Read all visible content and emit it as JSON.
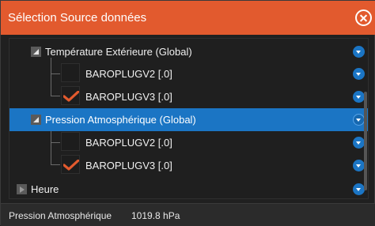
{
  "dialog": {
    "title": "Sélection Source données",
    "close_icon": "close-circle-icon"
  },
  "tree": [
    {
      "type": "group",
      "label": "Température Extérieure (Global)",
      "expanded": true,
      "selected": false
    },
    {
      "type": "source",
      "label": "BAROPLUGV2 [.0]",
      "checked": false
    },
    {
      "type": "source",
      "label": "BAROPLUGV3 [.0]",
      "checked": true
    },
    {
      "type": "group",
      "label": "Pression Atmosphérique (Global)",
      "expanded": true,
      "selected": true
    },
    {
      "type": "source",
      "label": "BAROPLUGV2 [.0]",
      "checked": false
    },
    {
      "type": "source",
      "label": "BAROPLUGV3 [.0]",
      "checked": true
    },
    {
      "type": "group",
      "label": "Heure",
      "expanded": false,
      "selected": false
    }
  ],
  "status": {
    "label": "Pression Atmosphérique",
    "value": "1019.8 hPa"
  },
  "colors": {
    "title_bar": "#e25a2e",
    "selection": "#1b75c4",
    "check": "#e25a2e"
  }
}
